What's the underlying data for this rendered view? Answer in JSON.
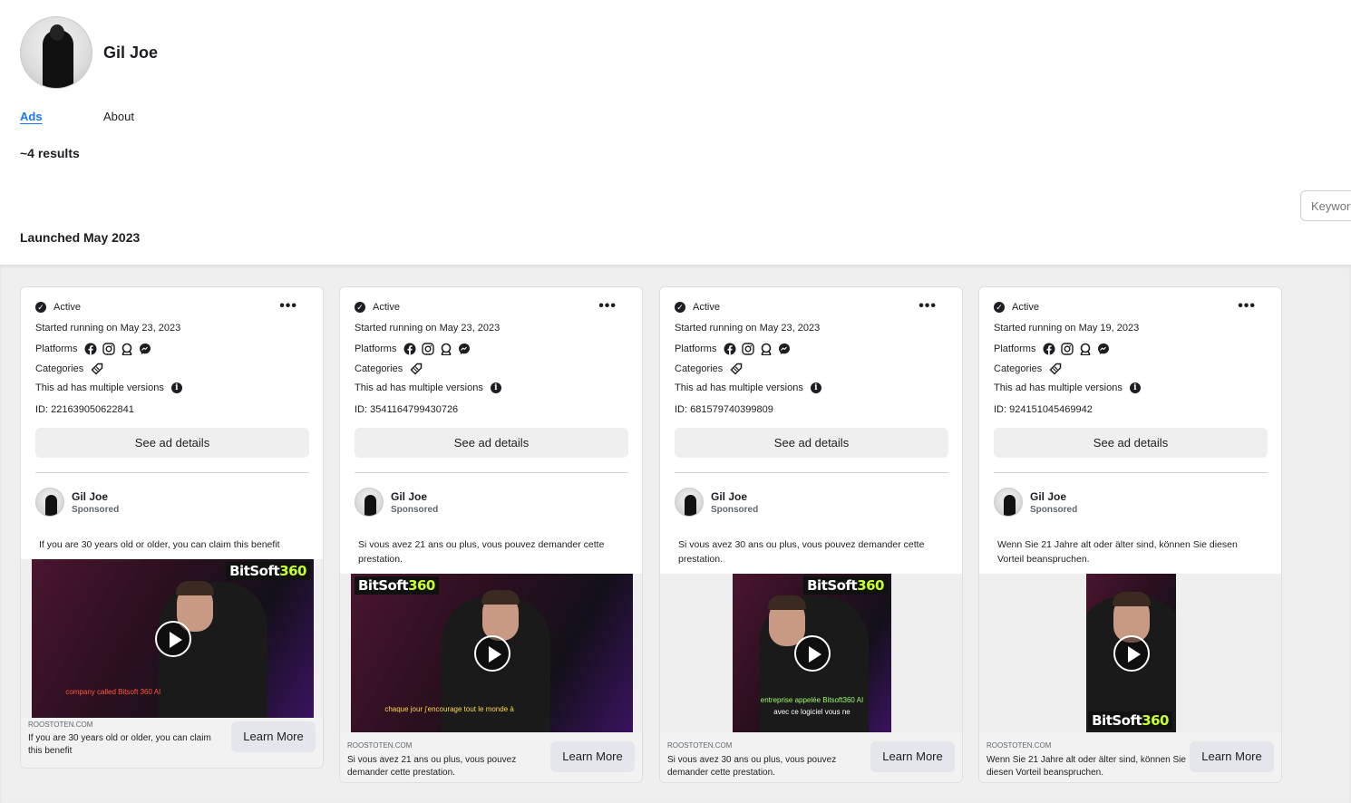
{
  "page": {
    "name": "Gil Joe",
    "tabs": [
      {
        "label": "Ads",
        "active": true
      },
      {
        "label": "About",
        "active": false
      }
    ],
    "results": "~4 results",
    "search_placeholder": "Keyword",
    "section_title": "Launched May 2023"
  },
  "labels": {
    "status": "Active",
    "platforms": "Platforms",
    "categories": "Categories",
    "multiple_versions": "This ad has multiple versions",
    "see_details": "See ad details",
    "sponsored": "Sponsored",
    "learn_more": "Learn More",
    "domain": "ROOSTOTEN.COM",
    "brand_prefix": "BitSoft",
    "brand_suffix": "360"
  },
  "cards": [
    {
      "started": "Started running on May 23, 2023",
      "id": "ID: 221639050622841",
      "advertiser": "Gil Joe",
      "body": "If you are 30 years old or older, you can claim this benefit",
      "subtitle": "company called Bitsoft 360 AI",
      "subtitle2": "",
      "caption": "If you are 30 years old or older, you can claim this benefit"
    },
    {
      "started": "Started running on May 23, 2023",
      "id": "ID: 3541164799430726",
      "advertiser": "Gil Joe",
      "body": "Si vous avez 21 ans ou plus, vous pouvez demander cette prestation.",
      "subtitle": "chaque jour j'encourage tout le monde à",
      "subtitle2": "",
      "caption": "Si vous avez 21 ans ou plus, vous pouvez demander cette prestation."
    },
    {
      "started": "Started running on May 23, 2023",
      "id": "ID: 681579740399809",
      "advertiser": "Gil Joe",
      "body": "Si vous avez 30 ans ou plus, vous pouvez demander cette prestation.",
      "subtitle": "entreprise appelée Bitsoft360 AI",
      "subtitle2": "avec ce logiciel vous ne",
      "caption": "Si vous avez 30 ans ou plus, vous pouvez demander cette prestation."
    },
    {
      "started": "Started running on May 19, 2023",
      "id": "ID: 924151045469942",
      "advertiser": "Gil Joe",
      "body": "Wenn Sie 21 Jahre alt oder älter sind, können Sie diesen Vorteil beanspruchen.",
      "subtitle": "",
      "subtitle2": "",
      "caption": "Wenn Sie 21 Jahre alt oder älter sind, können Sie diesen Vorteil beanspruchen."
    }
  ],
  "icons": [
    "facebook-icon",
    "instagram-icon",
    "audience-network-icon",
    "messenger-icon",
    "tag-icon",
    "info-icon",
    "check-icon",
    "more-icon",
    "play-icon"
  ],
  "colors": {
    "link": "#1877f2",
    "feed_bg": "#efefef",
    "brand_accent": "#c7ff2e"
  }
}
